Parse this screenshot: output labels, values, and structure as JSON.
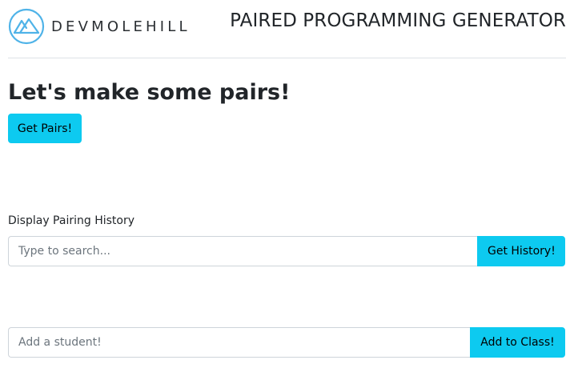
{
  "header": {
    "logo_text": "DEVMOLEHILL",
    "logo_icon": "mountain-icon",
    "app_title": "PAIRED PROGRAMMING GENERATOR"
  },
  "pairs": {
    "headline": "Let's make some pairs!",
    "button_label": "Get Pairs!"
  },
  "history": {
    "label": "Display Pairing History",
    "search_placeholder": "Type to search...",
    "search_value": "",
    "button_label": "Get History!"
  },
  "student": {
    "input_placeholder": "Add a student!",
    "input_value": "",
    "button_label": "Add to Class!"
  },
  "colors": {
    "accent": "#0dcaf0",
    "logo_ring": "#4fb3e8",
    "text": "#212529",
    "placeholder": "#6c757d",
    "border": "#ced4da",
    "divider": "#dee2e6"
  }
}
